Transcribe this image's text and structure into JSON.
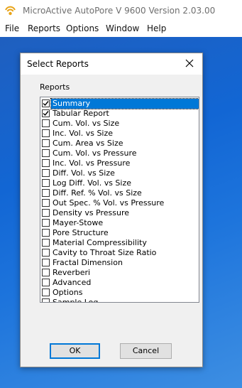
{
  "app": {
    "title": "MicroActive AutoPore V 9600 Version 2.03.00"
  },
  "menubar": {
    "items": [
      "File",
      "Reports",
      "Options",
      "Window",
      "Help"
    ]
  },
  "dialog": {
    "title": "Select Reports",
    "group_label": "Reports",
    "ok_label": "OK",
    "cancel_label": "Cancel",
    "items": [
      {
        "label": "Summary",
        "checked": true,
        "selected": true
      },
      {
        "label": "Tabular Report",
        "checked": true
      },
      {
        "label": "Cum. Vol. vs Size",
        "checked": false
      },
      {
        "label": "Inc. Vol. vs Size",
        "checked": false
      },
      {
        "label": "Cum. Area vs Size",
        "checked": false
      },
      {
        "label": "Cum. Vol. vs Pressure",
        "checked": false
      },
      {
        "label": "Inc. Vol. vs Pressure",
        "checked": false
      },
      {
        "label": "Diff. Vol. vs Size",
        "checked": false
      },
      {
        "label": "Log Diff. Vol. vs Size",
        "checked": false
      },
      {
        "label": "Diff. Ref. % Vol. vs Size",
        "checked": false
      },
      {
        "label": "Out Spec. % Vol. vs Pressure",
        "checked": false
      },
      {
        "label": "Density vs Pressure",
        "checked": false
      },
      {
        "label": "Mayer-Stowe",
        "checked": false
      },
      {
        "label": "Pore Structure",
        "checked": false
      },
      {
        "label": "Material Compressibility",
        "checked": false
      },
      {
        "label": "Cavity to Throat Size Ratio",
        "checked": false
      },
      {
        "label": "Fractal Dimension",
        "checked": false
      },
      {
        "label": "Reverberi",
        "checked": false
      },
      {
        "label": "Advanced",
        "checked": false
      },
      {
        "label": "Options",
        "checked": false
      },
      {
        "label": "Sample Log",
        "checked": false
      }
    ]
  }
}
